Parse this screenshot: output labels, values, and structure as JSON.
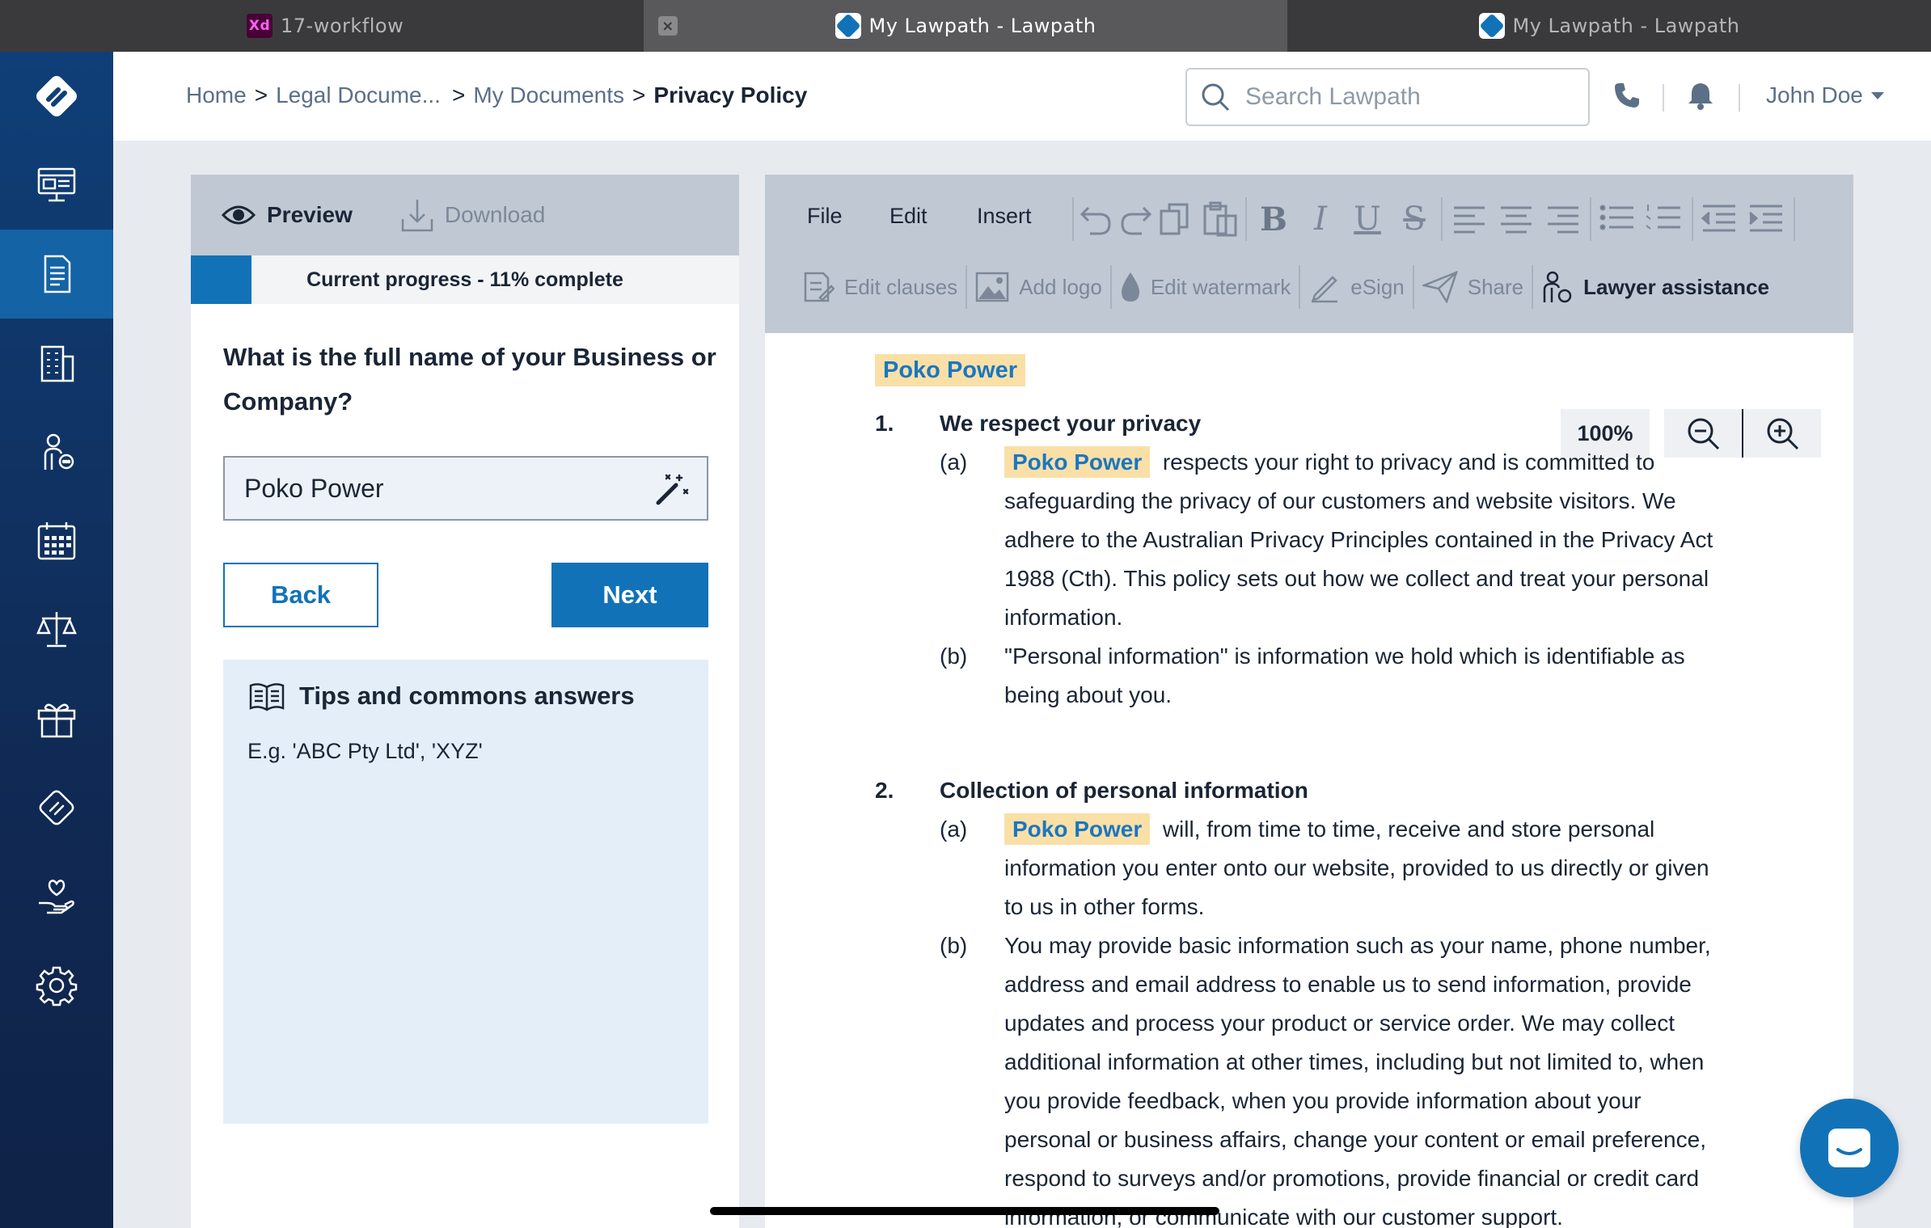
{
  "tabs": [
    {
      "badge": "Xd",
      "title": "17-workflow"
    },
    {
      "title": "My Lawpath - Lawpath",
      "close": "×"
    },
    {
      "title": "My Lawpath - Lawpath"
    }
  ],
  "sidebar": {
    "items": [
      {
        "icon": "dashboard-icon"
      },
      {
        "icon": "documents-icon",
        "active": true
      },
      {
        "icon": "company-icon"
      },
      {
        "icon": "lawyer-chat-icon"
      },
      {
        "icon": "calendar-icon"
      },
      {
        "icon": "legal-scales-icon"
      },
      {
        "icon": "gift-icon"
      },
      {
        "icon": "lawpath-logo-icon"
      },
      {
        "icon": "heart-hand-icon"
      },
      {
        "icon": "settings-icon"
      }
    ]
  },
  "header": {
    "breadcrumb": [
      "Home",
      "Legal Docume...",
      "My Documents",
      "Privacy Policy"
    ],
    "separator": ">",
    "search_placeholder": "Search Lawpath",
    "user_name": "John Doe"
  },
  "question_panel": {
    "tab_preview": "Preview",
    "tab_download": "Download",
    "progress_text": "Current progress - 11% complete",
    "progress_fraction": 0.11,
    "question": "What is the full name of your Business or Company?",
    "answer_value": "Poko Power",
    "back_label": "Back",
    "next_label": "Next",
    "tips_title": "Tips and commons answers",
    "tips_body": "E.g. 'ABC Pty Ltd', 'XYZ'"
  },
  "editor": {
    "menu": [
      "File",
      "Edit",
      "Insert"
    ],
    "tools": {
      "edit_clauses": "Edit clauses",
      "add_logo": "Add logo",
      "edit_watermark": "Edit watermark",
      "esign": "eSign",
      "share": "Share",
      "lawyer_assistance": "Lawyer assistance"
    },
    "zoom": "100%"
  },
  "document": {
    "company": "Poko Power",
    "sections": [
      {
        "num": "1.",
        "title": "We respect your privacy",
        "clauses": [
          {
            "label": "(a)",
            "text": "respects your right to privacy and is committed to safeguarding the privacy of our customers and website visitors. We adhere to the Australian Privacy Principles contained in the Privacy Act 1988 (Cth). This policy sets out how we collect and treat your personal information."
          },
          {
            "label": "(b)",
            "text": "\"Personal information\" is information we hold which is identifiable as being about you."
          }
        ]
      },
      {
        "num": "2.",
        "title": "Collection of personal information",
        "clauses": [
          {
            "label": "(a)",
            "text": "will, from time to time, receive and store personal information you enter onto our website, provided to us directly or given to us in other forms."
          },
          {
            "label": "(b)",
            "text": "You may provide basic information such as your name, phone number, address and email address to enable us to send information, provide updates and process your product or service order. We may collect additional information at other times, including but not limited to, when you provide feedback, when you provide information about your personal or business affairs, change your content or email preference, respond to surveys and/or promotions, provide financial or credit card information, or communicate with our customer support."
          }
        ]
      }
    ]
  },
  "colors": {
    "brand_blue": "#1272b8",
    "sidebar": "#0f2f5e",
    "highlight": "#fae0a7"
  }
}
